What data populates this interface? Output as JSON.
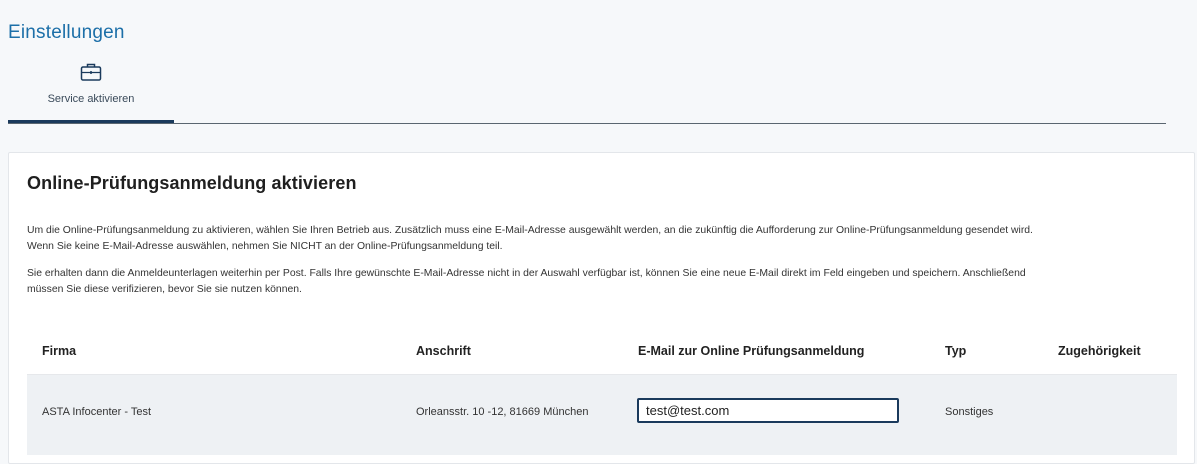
{
  "page": {
    "title": "Einstellungen"
  },
  "tabs": [
    {
      "label": "Service aktivieren",
      "icon": "briefcase-icon",
      "active": true
    }
  ],
  "card": {
    "title": "Online-Prüfungsanmeldung aktivieren",
    "paragraph1_line1": "Um die Online-Prüfungsanmeldung zu aktivieren, wählen Sie Ihren Betrieb aus. Zusätzlich muss eine E-Mail-Adresse ausgewählt werden, an die zukünftig die Aufforderung zur Online-Prüfungsanmeldung gesendet wird.",
    "paragraph1_line2": "Wenn Sie keine E-Mail-Adresse auswählen, nehmen Sie NICHT an der Online-Prüfungsanmeldung teil.",
    "paragraph2_line1": "Sie erhalten dann die Anmeldeunterlagen weiterhin per Post. Falls Ihre gewünschte E-Mail-Adresse nicht in der Auswahl verfügbar ist, können Sie eine neue E-Mail direkt im Feld eingeben und speichern. Anschließend",
    "paragraph2_line2": "müssen Sie diese verifizieren, bevor Sie sie nutzen können."
  },
  "table": {
    "headers": {
      "firma": "Firma",
      "anschrift": "Anschrift",
      "email": "E-Mail zur Online Prüfungsanmeldung",
      "typ": "Typ",
      "zugehoerigkeit": "Zugehörigkeit"
    },
    "rows": [
      {
        "firma": "ASTA Infocenter - Test",
        "anschrift": "Orleansstr. 10 -12, 81669 München",
        "email": "test@test.com",
        "typ": "Sonstiges",
        "zugehoerigkeit": ""
      }
    ]
  },
  "colors": {
    "accent": "#1c6fa8",
    "tab_active": "#1a3a5c",
    "row_bg": "#eef1f4"
  }
}
